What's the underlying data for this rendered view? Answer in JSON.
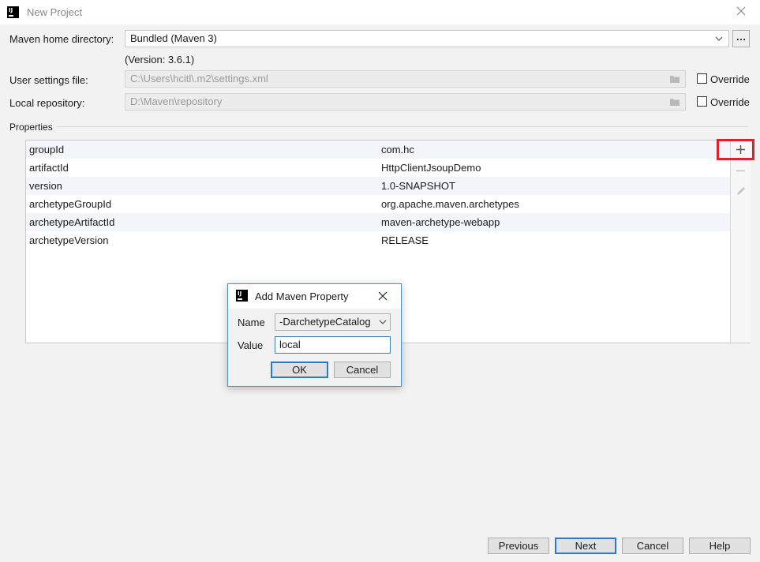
{
  "window": {
    "title": "New Project",
    "logo_text": "IJ"
  },
  "maven": {
    "home_label": "Maven home directory:",
    "home_value": "Bundled (Maven 3)",
    "version_text": "(Version: 3.6.1)",
    "settings_label": "User settings file:",
    "settings_value": "C:\\Users\\hcitl\\.m2\\settings.xml",
    "repo_label": "Local repository:",
    "repo_value": "D:\\Maven\\repository",
    "override_label": "Override"
  },
  "properties": {
    "section_label": "Properties",
    "rows": [
      {
        "key": "groupId",
        "value": "com.hc"
      },
      {
        "key": "artifactId",
        "value": "HttpClientJsoupDemo"
      },
      {
        "key": "version",
        "value": "1.0-SNAPSHOT"
      },
      {
        "key": "archetypeGroupId",
        "value": "org.apache.maven.archetypes"
      },
      {
        "key": "archetypeArtifactId",
        "value": "maven-archetype-webapp"
      },
      {
        "key": "archetypeVersion",
        "value": "RELEASE"
      }
    ]
  },
  "dialog": {
    "title": "Add Maven Property",
    "name_label": "Name",
    "name_value": "-DarchetypeCatalog",
    "value_label": "Value",
    "value_value": "local",
    "ok": "OK",
    "cancel": "Cancel"
  },
  "footer": {
    "previous": "Previous",
    "next": "Next",
    "cancel": "Cancel",
    "help": "Help"
  },
  "colors": {
    "highlight": "#e0202c",
    "focus": "#2a78cf"
  }
}
